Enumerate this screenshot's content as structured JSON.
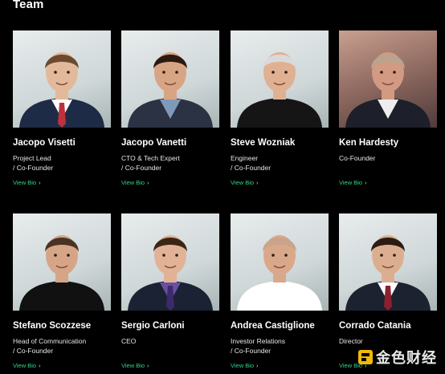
{
  "section": {
    "title": "Team"
  },
  "bio_label": "View Bio",
  "bio_chevron": "›",
  "members": [
    {
      "name": "Jacopo Visetti",
      "role_lines": [
        "Project Lead",
        "/ Co-Founder"
      ],
      "skin": "#e3b99c",
      "hair": "#6b4a2f",
      "outfit": "#1e2b47",
      "shirt": "#ffffff",
      "tie": "#c0303a",
      "bg": "light"
    },
    {
      "name": "Jacopo Vanetti",
      "role_lines": [
        "CTO & Tech Expert",
        "/ Co-Founder"
      ],
      "skin": "#d7a583",
      "hair": "#2b1a12",
      "outfit": "#2a3244",
      "shirt": "#7f9ab8",
      "tie": "",
      "bg": "light"
    },
    {
      "name": "Steve Wozniak",
      "role_lines": [
        "Engineer",
        "/ Co-Founder"
      ],
      "skin": "#e0b093",
      "hair": "#d9d9d9",
      "outfit": "#151515",
      "shirt": "#151515",
      "tie": "",
      "bg": "light"
    },
    {
      "name": "Ken Hardesty",
      "role_lines": [
        "Co-Founder"
      ],
      "skin": "#d29a82",
      "hair": "#b8a48f",
      "outfit": "#1d1f2a",
      "shirt": "#eeeeee",
      "tie": "",
      "bg": "warm"
    },
    {
      "name": "Stefano Scozzese",
      "role_lines": [
        "Head of Communication",
        "/ Co-Founder"
      ],
      "skin": "#d6a588",
      "hair": "#4a3324",
      "outfit": "#111111",
      "shirt": "#111111",
      "tie": "",
      "bg": "light"
    },
    {
      "name": "Sergio Carloni",
      "role_lines": [
        "CEO"
      ],
      "skin": "#e2b297",
      "hair": "#3b2616",
      "outfit": "#1a2233",
      "shirt": "#6b4fa0",
      "tie": "#3d2a6b",
      "bg": "light"
    },
    {
      "name": "Andrea Castiglione",
      "role_lines": [
        "Investor Relations",
        "/ Co-Founder"
      ],
      "skin": "#d9a88a",
      "hair": "#c9a48a",
      "outfit": "#ffffff",
      "shirt": "#ffffff",
      "tie": "",
      "bg": "light"
    },
    {
      "name": "Corrado Catania",
      "role_lines": [
        "Director"
      ],
      "skin": "#dcae90",
      "hair": "#2c1c13",
      "outfit": "#1c2230",
      "shirt": "#ffffff",
      "tie": "#8d1f2e",
      "bg": "light"
    }
  ],
  "watermark": {
    "text": "金色财经"
  }
}
